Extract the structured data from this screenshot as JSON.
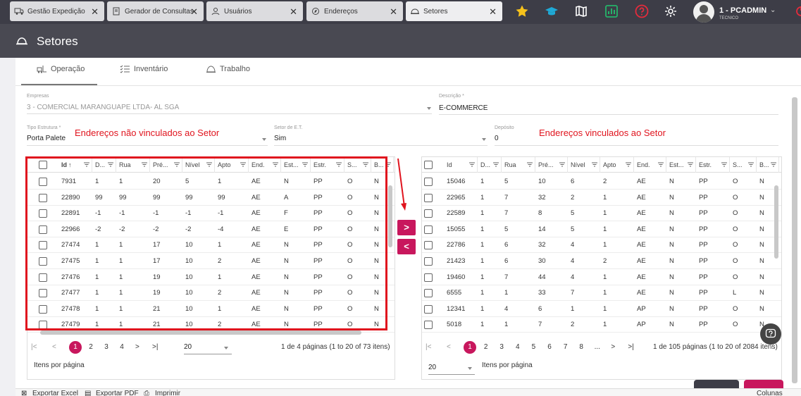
{
  "browser_tabs": [
    {
      "label": "Gestão Expedição",
      "icon": "truck-icon"
    },
    {
      "label": "Gerador de Consultas",
      "icon": "document-icon"
    },
    {
      "label": "Usuários",
      "icon": "user-icon"
    },
    {
      "label": "Endereços",
      "icon": "compass-icon"
    },
    {
      "label": "Setores",
      "icon": "hardhat-icon"
    }
  ],
  "top_icons": [
    "star-icon",
    "graduation-cap-icon",
    "map-icon",
    "chart-icon",
    "help-circle-icon",
    "gear-icon"
  ],
  "user": {
    "name": "1 - PCADMIN",
    "role": "TECNICO"
  },
  "page_title": "Setores",
  "subtabs": [
    {
      "label": "Operação",
      "icon": "forklift-icon"
    },
    {
      "label": "Inventário",
      "icon": "checklist-icon"
    },
    {
      "label": "Trabalho",
      "icon": "hardhat-icon"
    }
  ],
  "form": {
    "empresas_label": "Empresas",
    "empresas_value": "3 - COMERCIAL MARANGUAPE LTDA- AL SGA",
    "descricao_label": "Descrição *",
    "descricao_value": "E-COMMERCE",
    "tipo_label": "Tipo Estrutura *",
    "tipo_value": "Porta Palete",
    "setor_et_label": "Setor de E.T.",
    "setor_et_value": "Sim",
    "deposito_label": "Depósito",
    "deposito_value": "0"
  },
  "annotations": {
    "left": "Endereços não vinculados ao Setor",
    "right": "Endereços vinculados ao Setor"
  },
  "left_grid": {
    "columns": [
      "Id",
      "D...",
      "Rua",
      "Pré...",
      "Nível",
      "Apto",
      "End.",
      "Est...",
      "Estr.",
      "S...",
      "B..."
    ],
    "sort_indicator": "↑",
    "rows": [
      [
        "7931",
        "1",
        "1",
        "20",
        "5",
        "1",
        "AE",
        "N",
        "PP",
        "O",
        "N"
      ],
      [
        "22890",
        "99",
        "99",
        "99",
        "99",
        "99",
        "AE",
        "A",
        "PP",
        "O",
        "N"
      ],
      [
        "22891",
        "-1",
        "-1",
        "-1",
        "-1",
        "-1",
        "AE",
        "F",
        "PP",
        "O",
        "N"
      ],
      [
        "22966",
        "-2",
        "-2",
        "-2",
        "-2",
        "-4",
        "AE",
        "E",
        "PP",
        "O",
        "N"
      ],
      [
        "27474",
        "1",
        "1",
        "17",
        "10",
        "1",
        "AE",
        "N",
        "PP",
        "O",
        "N"
      ],
      [
        "27475",
        "1",
        "1",
        "17",
        "10",
        "2",
        "AE",
        "N",
        "PP",
        "O",
        "N"
      ],
      [
        "27476",
        "1",
        "1",
        "19",
        "10",
        "1",
        "AE",
        "N",
        "PP",
        "O",
        "N"
      ],
      [
        "27477",
        "1",
        "1",
        "19",
        "10",
        "2",
        "AE",
        "N",
        "PP",
        "O",
        "N"
      ],
      [
        "27478",
        "1",
        "1",
        "21",
        "10",
        "1",
        "AE",
        "N",
        "PP",
        "O",
        "N"
      ],
      [
        "27479",
        "1",
        "1",
        "21",
        "10",
        "2",
        "AE",
        "N",
        "PP",
        "O",
        "N"
      ]
    ],
    "pager": {
      "first": "|<",
      "prev": "<",
      "pages": [
        "1",
        "2",
        "3",
        "4"
      ],
      "next": ">",
      "last": ">|",
      "page_size": "20",
      "info": "1 de 4 páginas (1 to 20 of 73 itens)",
      "items_label": "Itens por página"
    }
  },
  "right_grid": {
    "columns": [
      "Id",
      "D...",
      "Rua",
      "Pré...",
      "Nível",
      "Apto",
      "End.",
      "Est...",
      "Estr.",
      "S...",
      "B..."
    ],
    "rows": [
      [
        "15046",
        "1",
        "5",
        "10",
        "6",
        "2",
        "AE",
        "N",
        "PP",
        "O",
        "N"
      ],
      [
        "22965",
        "1",
        "7",
        "32",
        "2",
        "1",
        "AE",
        "N",
        "PP",
        "O",
        "N"
      ],
      [
        "22589",
        "1",
        "7",
        "8",
        "5",
        "1",
        "AE",
        "N",
        "PP",
        "O",
        "N"
      ],
      [
        "15055",
        "1",
        "5",
        "14",
        "5",
        "1",
        "AE",
        "N",
        "PP",
        "O",
        "N"
      ],
      [
        "22786",
        "1",
        "6",
        "32",
        "4",
        "1",
        "AE",
        "N",
        "PP",
        "O",
        "N"
      ],
      [
        "21423",
        "1",
        "6",
        "30",
        "4",
        "2",
        "AE",
        "N",
        "PP",
        "O",
        "N"
      ],
      [
        "19460",
        "1",
        "7",
        "44",
        "4",
        "1",
        "AE",
        "N",
        "PP",
        "O",
        "N"
      ],
      [
        "6555",
        "1",
        "1",
        "33",
        "7",
        "1",
        "AE",
        "N",
        "PP",
        "L",
        "N"
      ],
      [
        "12341",
        "1",
        "4",
        "6",
        "1",
        "1",
        "AP",
        "N",
        "PP",
        "O",
        "N"
      ],
      [
        "5018",
        "1",
        "1",
        "7",
        "2",
        "1",
        "AP",
        "N",
        "PP",
        "O",
        "N"
      ]
    ],
    "pager": {
      "first": "|<",
      "prev": "<",
      "pages": [
        "1",
        "2",
        "3",
        "4",
        "5",
        "6",
        "7",
        "8",
        "..."
      ],
      "next": ">",
      "last": ">|",
      "page_size": "20",
      "info": "1 de 105 páginas (1 to 20 of 2084 itens)",
      "items_label": "Itens por página"
    }
  },
  "move_buttons": {
    "add": ">",
    "remove": "<"
  },
  "bottom_bar": {
    "export_excel": "Exportar Excel",
    "export_pdf": "Exportar PDF",
    "print": "Imprimir",
    "columns": "Colunas"
  },
  "colors": {
    "accent": "#c8175d",
    "annotation": "#e0141e",
    "topbar": "#3d3d47",
    "header": "#494952"
  }
}
